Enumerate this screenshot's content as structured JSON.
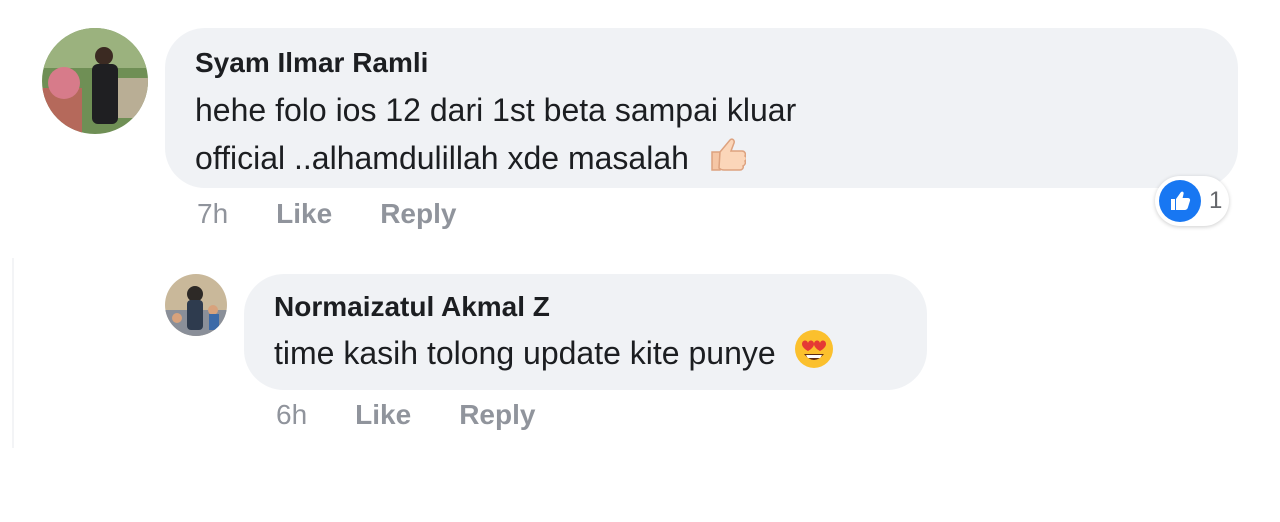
{
  "comments": [
    {
      "author": "Syam Ilmar Ramli",
      "text_line1": "hehe folo ios 12 dari 1st beta sampai  kluar",
      "text_line2": "official ..alhamdulillah xde masalah",
      "time": "7h",
      "like_label": "Like",
      "reply_label": "Reply",
      "reaction_count": "1",
      "emoji": "thumbs-up-icon"
    },
    {
      "author": "Normaizatul Akmal Z",
      "text": "time kasih tolong update kite punye",
      "time": "6h",
      "like_label": "Like",
      "reply_label": "Reply",
      "emoji": "heart-eyes-emoji-icon"
    }
  ],
  "colors": {
    "bubble": "#f0f2f5",
    "like_blue": "#1877f2",
    "meta_gray": "#90949c"
  }
}
